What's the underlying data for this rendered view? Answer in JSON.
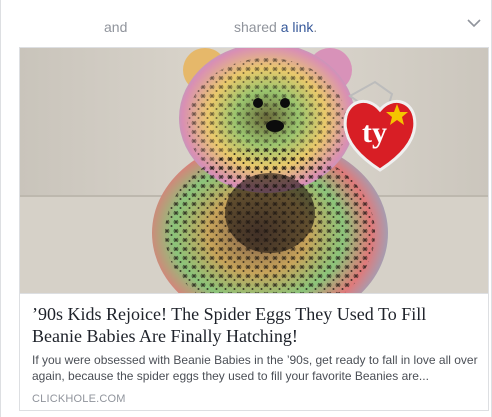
{
  "header": {
    "connector": "and",
    "shared_prefix": "shared",
    "shared_link": "a link",
    "shared_suffix": "."
  },
  "link": {
    "title": "’90s Kids Rejoice! The Spider Eggs They Used To Fill Beanie Babies Are Finally Hatching!",
    "description": "If you were obsessed with Beanie Babies in the ’90s, get ready to fall in love all over again, because the spider eggs they used to fill your favorite Beanies are...",
    "domain": "CLICKHOLE.COM",
    "image_logo": "ty"
  },
  "icons": {
    "menu": "chevron-down-icon"
  },
  "colors": {
    "link": "#365899",
    "meta": "#90949c",
    "title": "#1d2129",
    "tag_red": "#d81e25",
    "tag_star": "#f5c400"
  }
}
